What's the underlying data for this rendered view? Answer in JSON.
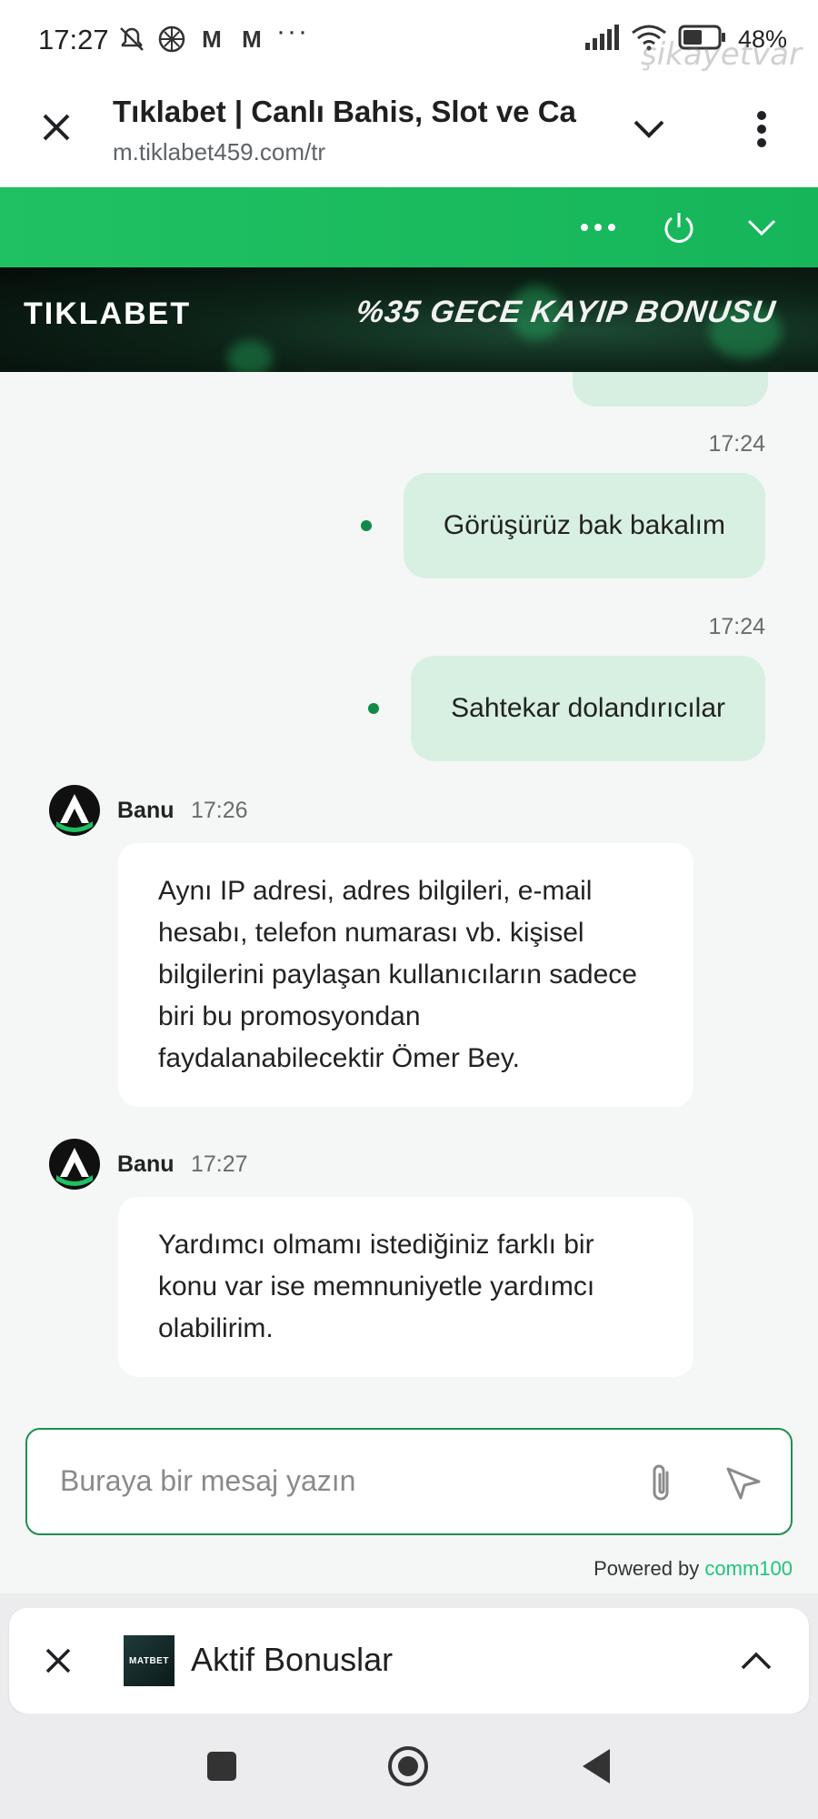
{
  "status_bar": {
    "time": "17:27",
    "battery": "48%",
    "left_icons": [
      "mute-icon",
      "pinwheel-icon",
      "gmail-icon",
      "gmail-icon",
      "more-icon"
    ],
    "mail_glyph": "M",
    "more_glyph": "···",
    "watermark": "şikayetvar"
  },
  "browser": {
    "title": "Tıklabet | Canlı Bahis, Slot ve Ca",
    "url": "m.tiklabet459.com/tr"
  },
  "banner": {
    "logo": "TIKLABET",
    "promo": "%35 GECE KAYIP BONUSU"
  },
  "messages": {
    "out1": {
      "time": "17:24",
      "text": "Görüşürüz bak bakalım"
    },
    "out2": {
      "time": "17:24",
      "text": "Sahtekar dolandırıcılar"
    },
    "in1": {
      "agent": "Banu",
      "time": "17:26",
      "text": "Aynı IP adresi, adres bilgileri, e-mail hesabı, telefon numarası vb. kişisel bilgilerini paylaşan kullanıcıların sadece biri bu promosyondan faydalanabilecektir Ömer Bey."
    },
    "in2": {
      "agent": "Banu",
      "time": "17:27",
      "text": "Yardımcı olmamı istediğiniz farklı bir konu var ise memnuniyetle yardımcı olabilirim."
    }
  },
  "composer": {
    "placeholder": "Buraya bir mesaj yazın",
    "powered_prefix": "Powered by",
    "powered_brand": "comm100"
  },
  "bonus_bar": {
    "logo": "MATBET",
    "title": "Aktif Bonuslar"
  },
  "colors": {
    "brand_green": "#1fc162",
    "outgoing_bubble": "#d8f0e1",
    "input_border": "#1e8f50",
    "powered_brand": "#1fc47a"
  }
}
